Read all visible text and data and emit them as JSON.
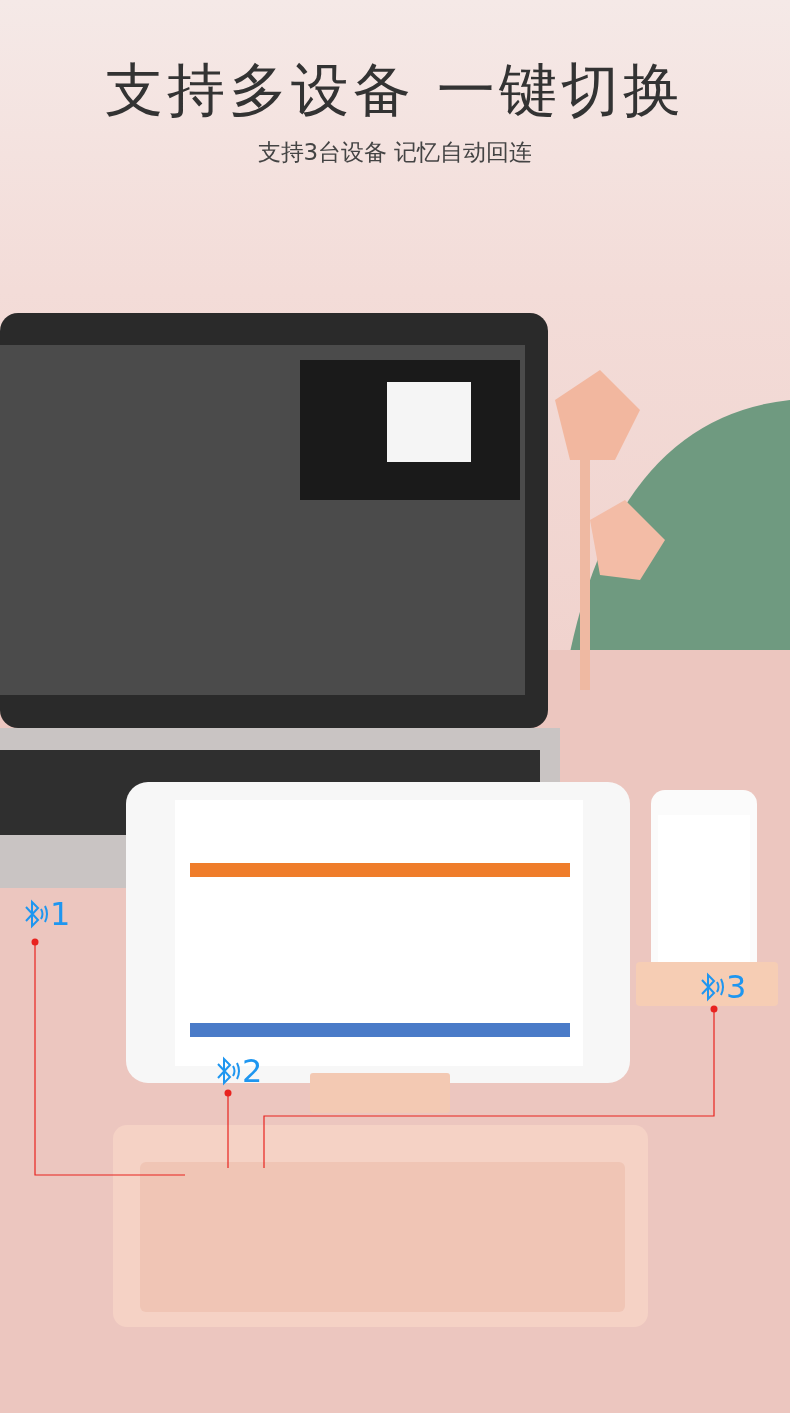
{
  "title": "支持多设备 一键切换",
  "subtitle": "支持3台设备 记忆自动回连",
  "connections": [
    {
      "label": "1"
    },
    {
      "label": "2"
    },
    {
      "label": "3"
    }
  ]
}
